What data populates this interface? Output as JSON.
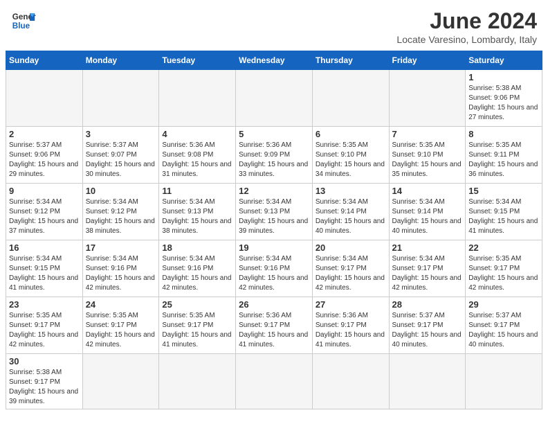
{
  "logo": {
    "line1": "General",
    "line2": "Blue"
  },
  "title": "June 2024",
  "subtitle": "Locate Varesino, Lombardy, Italy",
  "days_of_week": [
    "Sunday",
    "Monday",
    "Tuesday",
    "Wednesday",
    "Thursday",
    "Friday",
    "Saturday"
  ],
  "weeks": [
    [
      {
        "day": "",
        "info": ""
      },
      {
        "day": "",
        "info": ""
      },
      {
        "day": "",
        "info": ""
      },
      {
        "day": "",
        "info": ""
      },
      {
        "day": "",
        "info": ""
      },
      {
        "day": "",
        "info": ""
      },
      {
        "day": "1",
        "info": "Sunrise: 5:38 AM\nSunset: 9:06 PM\nDaylight: 15 hours\nand 27 minutes."
      }
    ],
    [
      {
        "day": "2",
        "info": "Sunrise: 5:37 AM\nSunset: 9:06 PM\nDaylight: 15 hours\nand 29 minutes."
      },
      {
        "day": "3",
        "info": "Sunrise: 5:37 AM\nSunset: 9:07 PM\nDaylight: 15 hours\nand 30 minutes."
      },
      {
        "day": "4",
        "info": "Sunrise: 5:36 AM\nSunset: 9:08 PM\nDaylight: 15 hours\nand 31 minutes."
      },
      {
        "day": "5",
        "info": "Sunrise: 5:36 AM\nSunset: 9:09 PM\nDaylight: 15 hours\nand 33 minutes."
      },
      {
        "day": "6",
        "info": "Sunrise: 5:35 AM\nSunset: 9:10 PM\nDaylight: 15 hours\nand 34 minutes."
      },
      {
        "day": "7",
        "info": "Sunrise: 5:35 AM\nSunset: 9:10 PM\nDaylight: 15 hours\nand 35 minutes."
      },
      {
        "day": "8",
        "info": "Sunrise: 5:35 AM\nSunset: 9:11 PM\nDaylight: 15 hours\nand 36 minutes."
      }
    ],
    [
      {
        "day": "9",
        "info": "Sunrise: 5:34 AM\nSunset: 9:12 PM\nDaylight: 15 hours\nand 37 minutes."
      },
      {
        "day": "10",
        "info": "Sunrise: 5:34 AM\nSunset: 9:12 PM\nDaylight: 15 hours\nand 38 minutes."
      },
      {
        "day": "11",
        "info": "Sunrise: 5:34 AM\nSunset: 9:13 PM\nDaylight: 15 hours\nand 38 minutes."
      },
      {
        "day": "12",
        "info": "Sunrise: 5:34 AM\nSunset: 9:13 PM\nDaylight: 15 hours\nand 39 minutes."
      },
      {
        "day": "13",
        "info": "Sunrise: 5:34 AM\nSunset: 9:14 PM\nDaylight: 15 hours\nand 40 minutes."
      },
      {
        "day": "14",
        "info": "Sunrise: 5:34 AM\nSunset: 9:14 PM\nDaylight: 15 hours\nand 40 minutes."
      },
      {
        "day": "15",
        "info": "Sunrise: 5:34 AM\nSunset: 9:15 PM\nDaylight: 15 hours\nand 41 minutes."
      }
    ],
    [
      {
        "day": "16",
        "info": "Sunrise: 5:34 AM\nSunset: 9:15 PM\nDaylight: 15 hours\nand 41 minutes."
      },
      {
        "day": "17",
        "info": "Sunrise: 5:34 AM\nSunset: 9:16 PM\nDaylight: 15 hours\nand 42 minutes."
      },
      {
        "day": "18",
        "info": "Sunrise: 5:34 AM\nSunset: 9:16 PM\nDaylight: 15 hours\nand 42 minutes."
      },
      {
        "day": "19",
        "info": "Sunrise: 5:34 AM\nSunset: 9:16 PM\nDaylight: 15 hours\nand 42 minutes."
      },
      {
        "day": "20",
        "info": "Sunrise: 5:34 AM\nSunset: 9:17 PM\nDaylight: 15 hours\nand 42 minutes."
      },
      {
        "day": "21",
        "info": "Sunrise: 5:34 AM\nSunset: 9:17 PM\nDaylight: 15 hours\nand 42 minutes."
      },
      {
        "day": "22",
        "info": "Sunrise: 5:35 AM\nSunset: 9:17 PM\nDaylight: 15 hours\nand 42 minutes."
      }
    ],
    [
      {
        "day": "23",
        "info": "Sunrise: 5:35 AM\nSunset: 9:17 PM\nDaylight: 15 hours\nand 42 minutes."
      },
      {
        "day": "24",
        "info": "Sunrise: 5:35 AM\nSunset: 9:17 PM\nDaylight: 15 hours\nand 42 minutes."
      },
      {
        "day": "25",
        "info": "Sunrise: 5:35 AM\nSunset: 9:17 PM\nDaylight: 15 hours\nand 41 minutes."
      },
      {
        "day": "26",
        "info": "Sunrise: 5:36 AM\nSunset: 9:17 PM\nDaylight: 15 hours\nand 41 minutes."
      },
      {
        "day": "27",
        "info": "Sunrise: 5:36 AM\nSunset: 9:17 PM\nDaylight: 15 hours\nand 41 minutes."
      },
      {
        "day": "28",
        "info": "Sunrise: 5:37 AM\nSunset: 9:17 PM\nDaylight: 15 hours\nand 40 minutes."
      },
      {
        "day": "29",
        "info": "Sunrise: 5:37 AM\nSunset: 9:17 PM\nDaylight: 15 hours\nand 40 minutes."
      }
    ],
    [
      {
        "day": "30",
        "info": "Sunrise: 5:38 AM\nSunset: 9:17 PM\nDaylight: 15 hours\nand 39 minutes."
      },
      {
        "day": "",
        "info": ""
      },
      {
        "day": "",
        "info": ""
      },
      {
        "day": "",
        "info": ""
      },
      {
        "day": "",
        "info": ""
      },
      {
        "day": "",
        "info": ""
      },
      {
        "day": "",
        "info": ""
      }
    ]
  ]
}
